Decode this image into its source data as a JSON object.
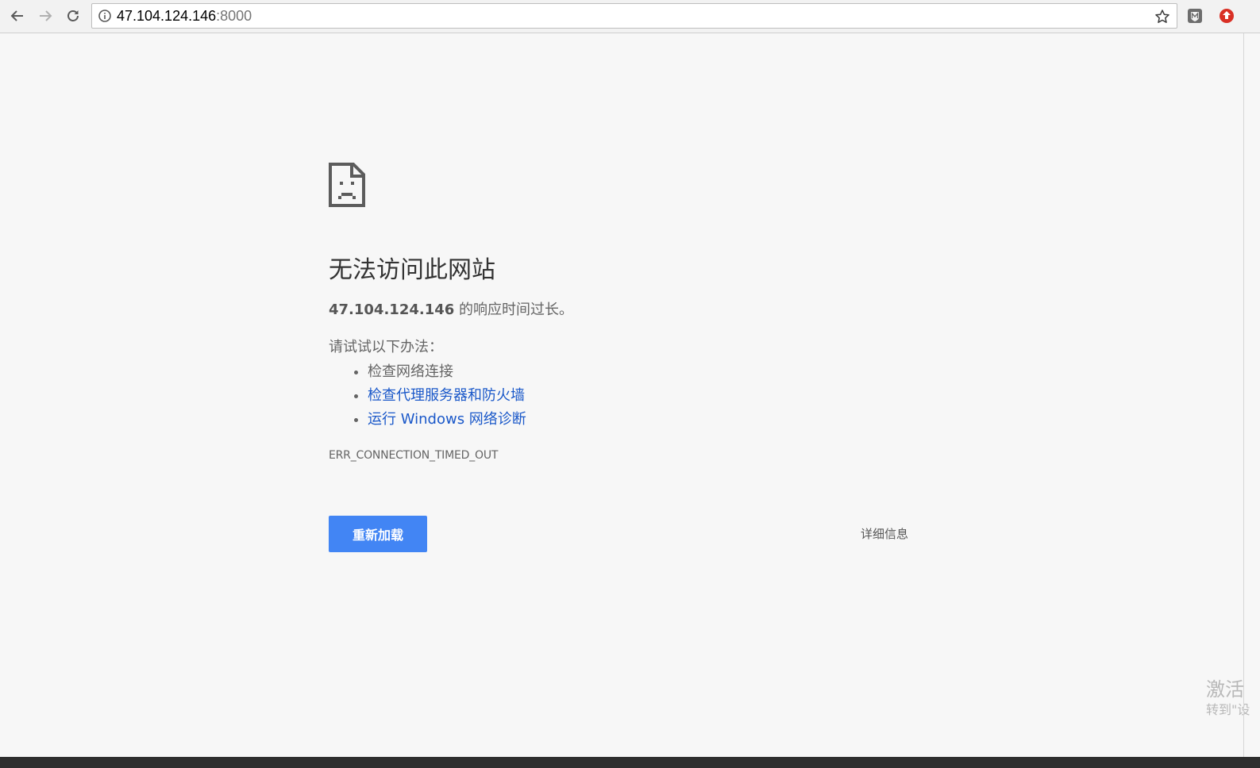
{
  "browser": {
    "url_host": "47.104.124.146",
    "url_port": ":8000",
    "icons": {
      "back": "arrow-left-icon",
      "forward": "arrow-right-icon",
      "reload": "reload-icon",
      "info": "info-circle-icon",
      "bookmark": "star-outline-icon",
      "extension1": "m-shield-extension-icon",
      "extension2": "red-circle-extension-icon"
    }
  },
  "error_page": {
    "title": "无法访问此网站",
    "host": "47.104.124.146",
    "description_suffix": " 的响应时间过长。",
    "try_label": "请试试以下办法：",
    "suggestions": [
      "检查网络连接",
      "检查代理服务器和防火墙",
      "运行 Windows 网络诊断"
    ],
    "error_code": "ERR_CONNECTION_TIMED_OUT",
    "reload_label": "重新加载",
    "details_label": "详细信息"
  },
  "watermark": {
    "line1": "激活",
    "line2": "转到\"设"
  },
  "colors": {
    "accent": "#4285f4",
    "link": "#1a58c9",
    "background": "#f7f7f7"
  }
}
